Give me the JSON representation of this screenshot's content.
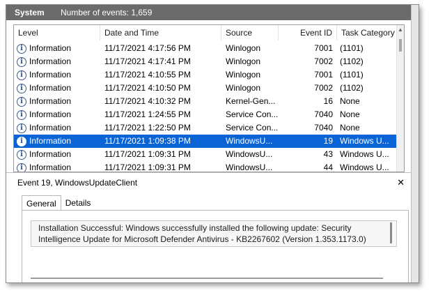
{
  "titlebar": {
    "log_name": "System",
    "event_count": "Number of events: 1,659"
  },
  "columns": {
    "level": "Level",
    "date": "Date and Time",
    "source": "Source",
    "event_id": "Event ID",
    "category": "Task Category"
  },
  "rows": [
    {
      "level": "Information",
      "date": "11/17/2021 4:17:56 PM",
      "source": "Winlogon",
      "event_id": "7001",
      "category": "(1101)"
    },
    {
      "level": "Information",
      "date": "11/17/2021 4:17:41 PM",
      "source": "Winlogon",
      "event_id": "7002",
      "category": "(1102)"
    },
    {
      "level": "Information",
      "date": "11/17/2021 4:10:55 PM",
      "source": "Winlogon",
      "event_id": "7001",
      "category": "(1101)"
    },
    {
      "level": "Information",
      "date": "11/17/2021 4:10:50 PM",
      "source": "Winlogon",
      "event_id": "7002",
      "category": "(1102)"
    },
    {
      "level": "Information",
      "date": "11/17/2021 4:10:32 PM",
      "source": "Kernel-Gen...",
      "event_id": "16",
      "category": "None"
    },
    {
      "level": "Information",
      "date": "11/17/2021 1:24:55 PM",
      "source": "Service Con...",
      "event_id": "7040",
      "category": "None"
    },
    {
      "level": "Information",
      "date": "11/17/2021 1:22:50 PM",
      "source": "Service Con...",
      "event_id": "7040",
      "category": "None"
    },
    {
      "level": "Information",
      "date": "11/17/2021 1:09:38 PM",
      "source": "WindowsU...",
      "event_id": "19",
      "category": "Windows U...",
      "selected": true
    },
    {
      "level": "Information",
      "date": "11/17/2021 1:09:31 PM",
      "source": "WindowsU...",
      "event_id": "43",
      "category": "Windows U..."
    },
    {
      "level": "Information",
      "date": "11/17/2021 1:09:31 PM",
      "source": "WindowsU...",
      "event_id": "44",
      "category": "Windows U..."
    }
  ],
  "detail": {
    "title": "Event 19, WindowsUpdateClient",
    "close_glyph": "✕",
    "tabs": [
      "General",
      "Details"
    ],
    "message": "Installation Successful: Windows successfully installed the following update: Security Intelligence Update for Microsoft Defender Antivirus - KB2267602 (Version 1.353.1173.0)"
  },
  "icons": {
    "level_icon": "information-icon",
    "close_icon": "close-icon"
  },
  "colors": {
    "selection": "#0a64d6",
    "titlebar": "#6b6b6b"
  }
}
